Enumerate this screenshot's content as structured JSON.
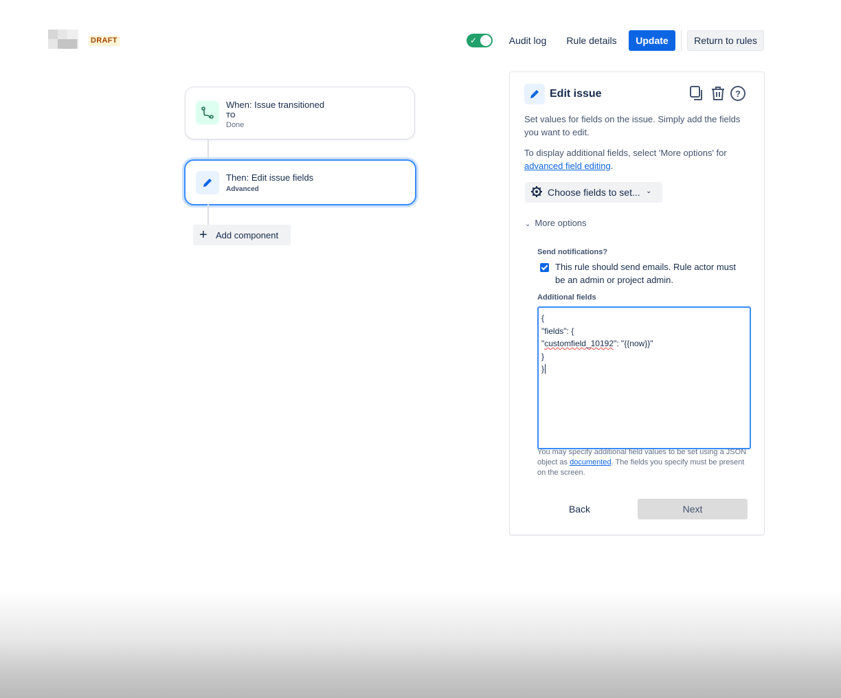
{
  "header": {
    "draft_badge": "DRAFT",
    "rule_enabled": true,
    "audit_log": "Audit log",
    "rule_details": "Rule details",
    "update": "Update",
    "return_to_rules": "Return to rules"
  },
  "flow": {
    "trigger": {
      "title": "When: Issue transitioned",
      "sub_label": "TO",
      "sub_value": "Done"
    },
    "action": {
      "title": "Then: Edit issue fields",
      "sub_label": "Advanced"
    },
    "add_component": "Add component"
  },
  "panel": {
    "title": "Edit issue",
    "desc": "Set values for fields on the issue. Simply add the fields you want to edit.",
    "desc2_prefix": "To display additional fields, select 'More options' for ",
    "desc2_link": "advanced field editing",
    "desc2_suffix": ".",
    "choose_fields": "Choose fields to set...",
    "more_options": "More options",
    "send_notifications_label": "Send notifications?",
    "send_notifications_checked": true,
    "send_notifications_text": "This rule should send emails. Rule actor must be an admin or project admin.",
    "additional_fields_label": "Additional fields",
    "code_lines": {
      "l1": "{",
      "l2": "\"fields\": {",
      "l3_key": "customfield_10192",
      "l3_rest": "\": \"{{now}}\"",
      "l4": "}",
      "l5": "}"
    },
    "help_prefix": "You may specify additional field values to be set using a JSON object as ",
    "help_link": "documented",
    "help_suffix": ". The fields you specify must be present on the screen.",
    "back": "Back",
    "next": "Next"
  },
  "colors": {
    "primary": "#0c66e4",
    "toggle_on": "#22a06b",
    "selected_border": "#388bff",
    "draft_bg": "#fff4d6",
    "draft_text": "#a54800"
  }
}
